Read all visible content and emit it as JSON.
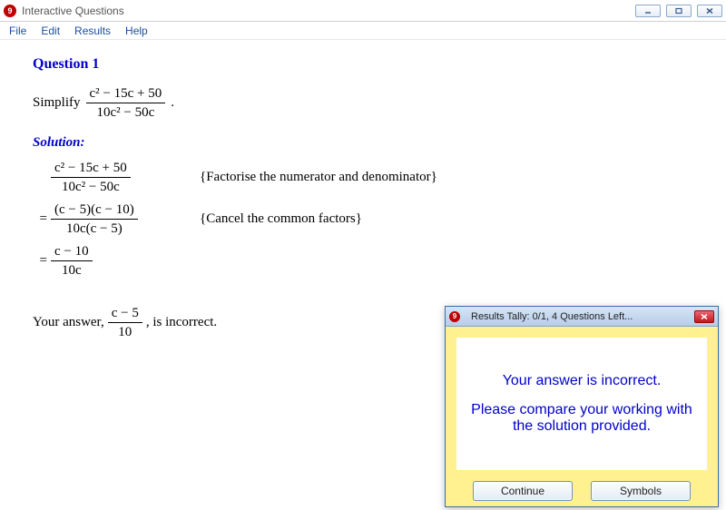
{
  "window": {
    "title": "Interactive Questions",
    "icon_glyph": "9"
  },
  "menu": {
    "items": [
      "File",
      "Edit",
      "Results",
      "Help"
    ]
  },
  "question": {
    "title": "Question 1",
    "prompt_prefix": "Simplify ",
    "prompt_frac_num": "c² − 15c + 50",
    "prompt_frac_den": "10c² − 50c",
    "prompt_suffix": ".",
    "solution_label": "Solution:",
    "steps": [
      {
        "eq": "",
        "num": "c² − 15c + 50",
        "den": "10c² − 50c",
        "hint": "{Factorise the numerator and denominator}"
      },
      {
        "eq": "=",
        "num": "(c − 5)(c − 10)",
        "den": "10c(c − 5)",
        "hint": "{Cancel the common factors}"
      },
      {
        "eq": "=",
        "num": "c − 10",
        "den": "10c",
        "hint": ""
      }
    ],
    "answer_prefix": "Your answer, ",
    "answer_frac_num": "c − 5",
    "answer_frac_den": "10",
    "answer_suffix": ", is incorrect."
  },
  "tally": {
    "title": "Results Tally:  0/1, 4 Questions Left...",
    "icon_glyph": "9",
    "line1": "Your answer is incorrect.",
    "line2": "Please compare your working with the solution provided.",
    "continue_label": "Continue",
    "symbols_label": "Symbols"
  }
}
